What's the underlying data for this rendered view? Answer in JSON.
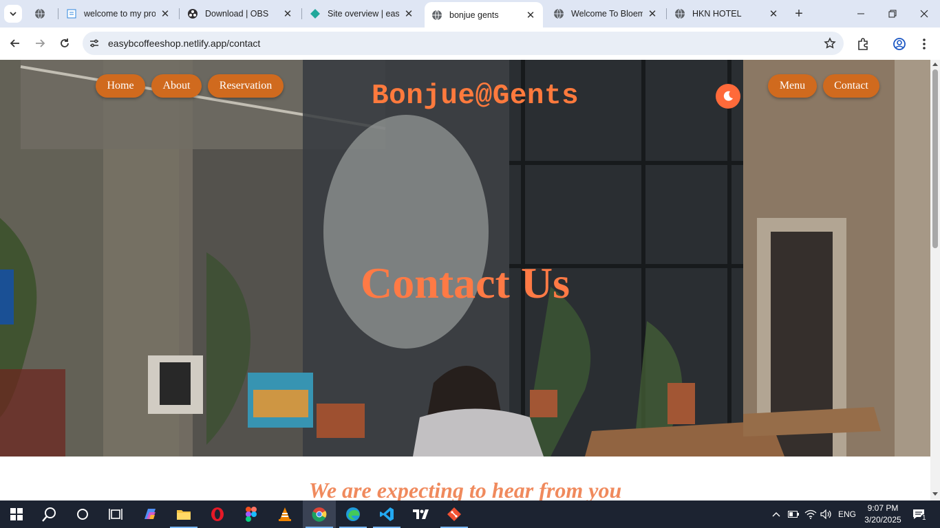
{
  "browser": {
    "tabs": [
      {
        "title": "",
        "favicon": "globe-icon"
      },
      {
        "title": "welcome to my proj",
        "favicon": "document-icon"
      },
      {
        "title": "Download | OBS",
        "favicon": "obs-icon"
      },
      {
        "title": "Site overview | easyb",
        "favicon": "netlify-icon"
      },
      {
        "title": "bonjue gents",
        "favicon": "globe-icon",
        "active": true
      },
      {
        "title": "Welcome To Bloemb",
        "favicon": "globe-icon"
      },
      {
        "title": "HKN HOTEL",
        "favicon": "globe-icon"
      }
    ],
    "url": "easybcoffeeshop.netlify.app/contact"
  },
  "page": {
    "nav_left": [
      "Home",
      "About",
      "Reservation"
    ],
    "brand": "Bonjue@Gents",
    "nav_right": [
      "Menu",
      "Contact"
    ],
    "hero_title": "Contact Us",
    "subheading": "We are expecting to hear from you"
  },
  "colors": {
    "nav_pill": "#d06a1e",
    "accent": "#ff7a3d",
    "theme_toggle": "#ff6a3a"
  },
  "taskbar": {
    "apps": [
      "start",
      "search",
      "cortana",
      "task-view",
      "copilot",
      "file-explorer",
      "opera",
      "figma",
      "vlc",
      "chrome",
      "edge",
      "vscode",
      "tradingview",
      "git"
    ],
    "tray": {
      "language": "ENG",
      "notifications": "1"
    },
    "time": "9:07 PM",
    "date": "3/20/2025"
  }
}
